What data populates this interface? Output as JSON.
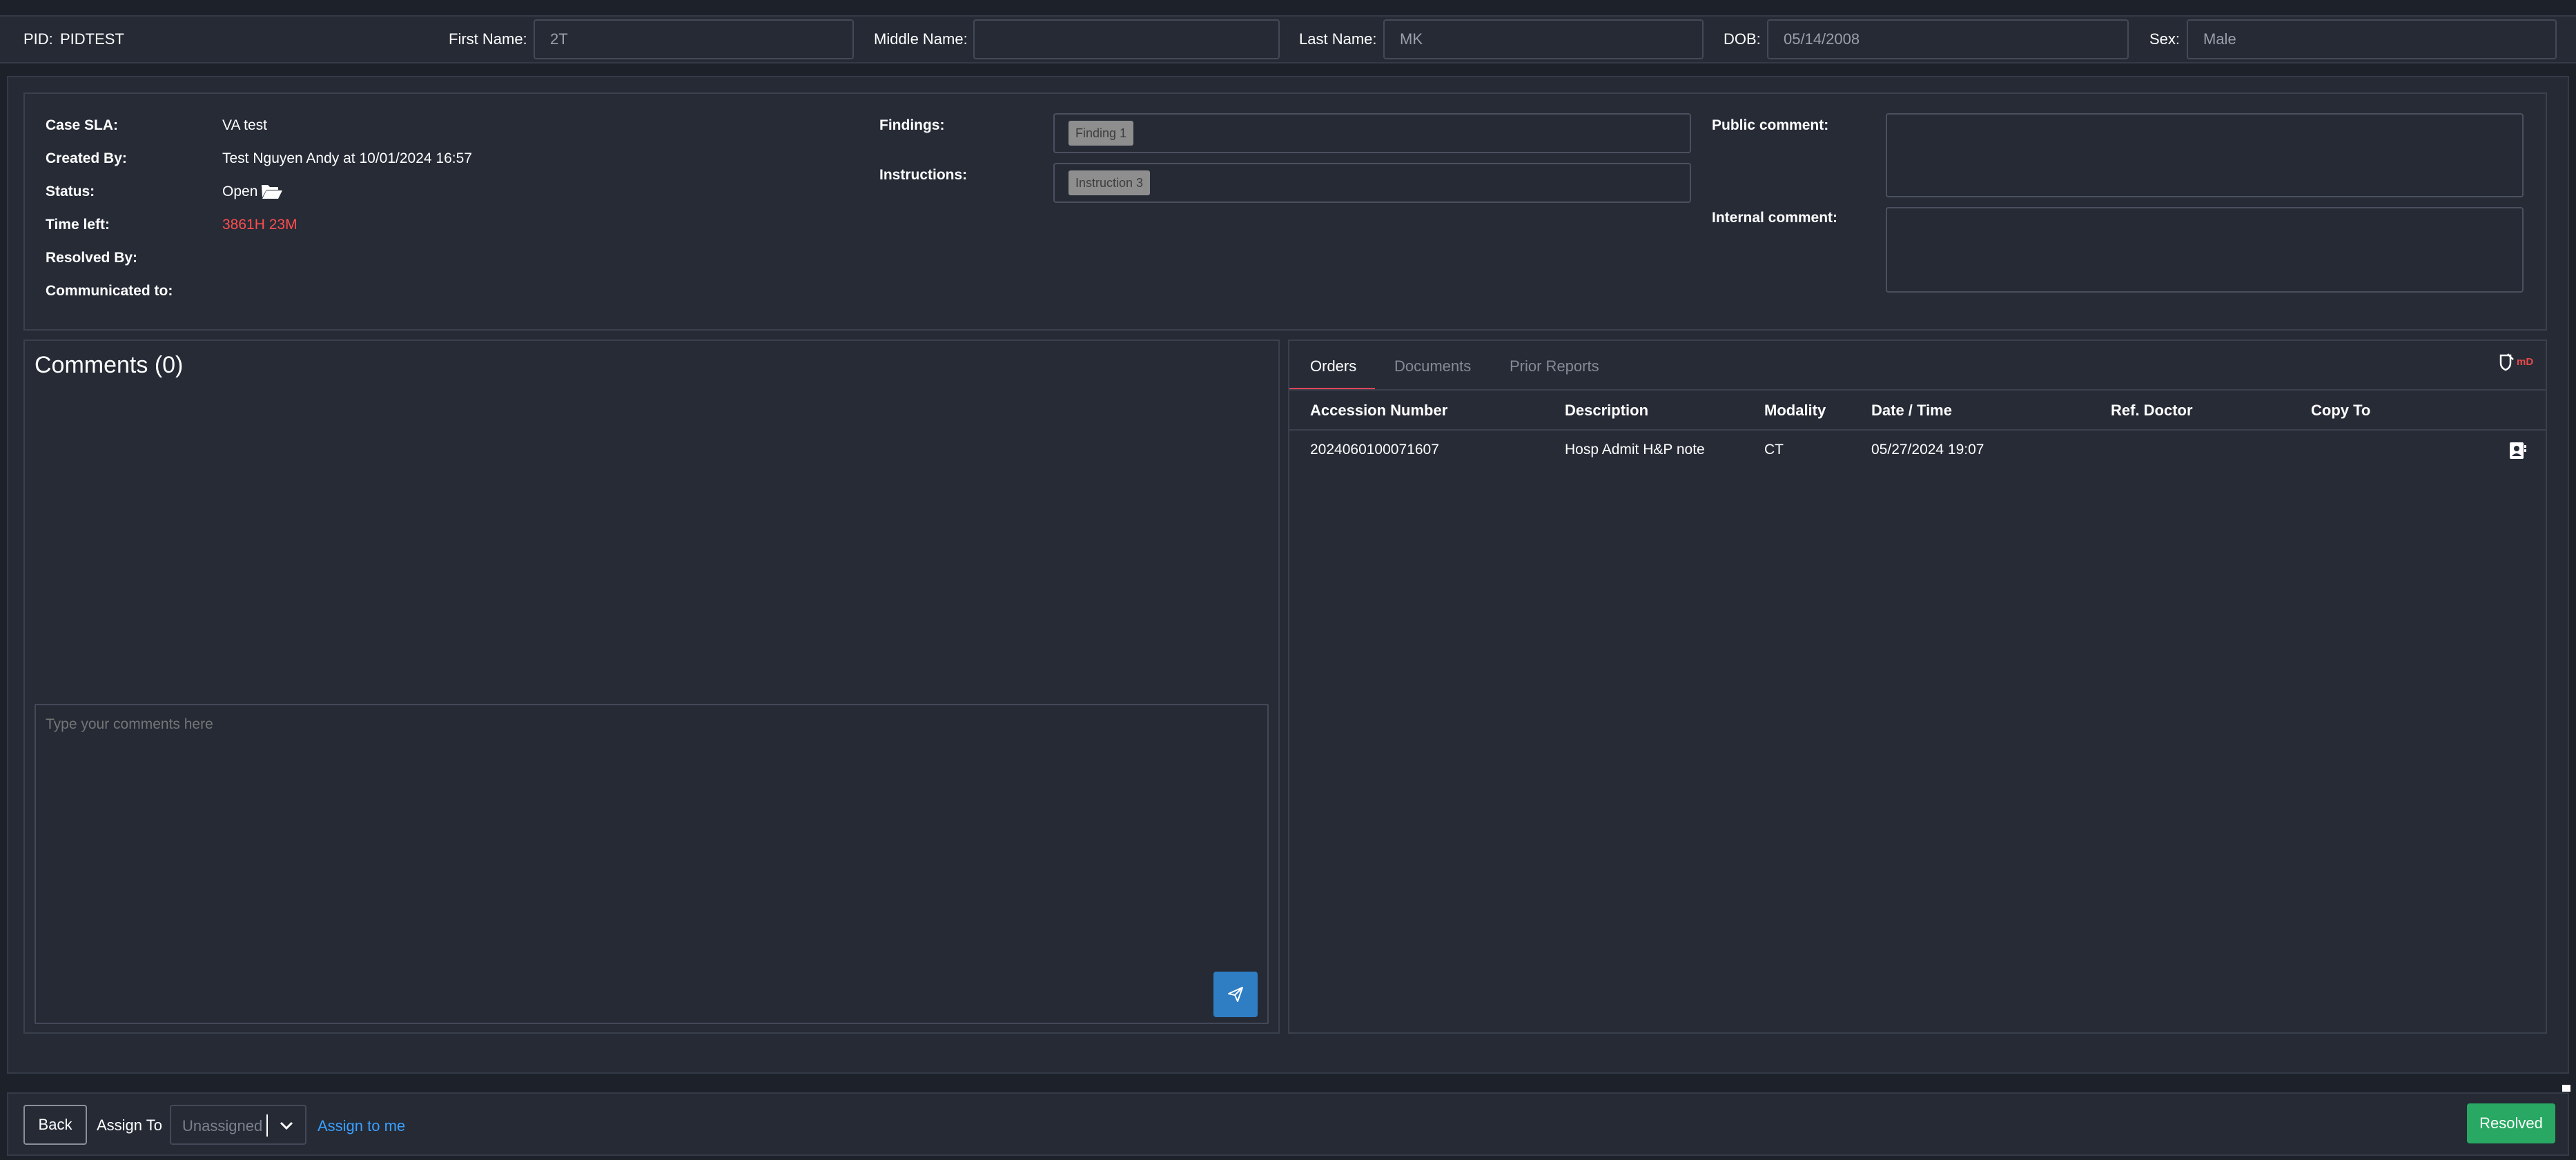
{
  "patient": {
    "pid_label": "PID:",
    "pid_value": "PIDTEST",
    "first_name_label": "First Name:",
    "first_name_value": "2T",
    "middle_name_label": "Middle Name:",
    "middle_name_value": "",
    "last_name_label": "Last Name:",
    "last_name_value": "MK",
    "dob_label": "DOB:",
    "dob_value": "05/14/2008",
    "sex_label": "Sex:",
    "sex_value": "Male"
  },
  "case": {
    "sla_label": "Case SLA:",
    "sla_value": "VA test",
    "created_by_label": "Created By:",
    "created_by_value": "Test Nguyen Andy at 10/01/2024 16:57",
    "status_label": "Status:",
    "status_value": "Open",
    "status_icon": "folder-open-icon",
    "time_left_label": "Time left:",
    "time_left_value": "3861H 23M",
    "time_left_color": "#ff4d4f",
    "resolved_by_label": "Resolved By:",
    "resolved_by_value": "",
    "communicated_label": "Communicated to:",
    "communicated_value": ""
  },
  "findings": {
    "label": "Findings:",
    "tags": [
      "Finding 1"
    ]
  },
  "instructions": {
    "label": "Instructions:",
    "tags": [
      "Instruction 3"
    ]
  },
  "public_comment": {
    "label": "Public comment:",
    "value": ""
  },
  "internal_comment": {
    "label": "Internal comment:",
    "value": ""
  },
  "comments": {
    "title": "Comments (0)",
    "placeholder": "Type your comments here",
    "send_icon": "paper-plane-icon"
  },
  "tabs": [
    {
      "label": "Orders",
      "active": true
    },
    {
      "label": "Documents",
      "active": false
    },
    {
      "label": "Prior Reports",
      "active": false
    }
  ],
  "brand": {
    "text": "mD",
    "color": "#e84a4a"
  },
  "orders": {
    "columns": [
      "Accession Number",
      "Description",
      "Modality",
      "Date / Time",
      "Ref. Doctor",
      "Copy To"
    ],
    "rows": [
      {
        "accession": "2024060100071607",
        "description": "Hosp Admit H&P note",
        "modality": "CT",
        "datetime": "05/27/2024 19:07",
        "ref_doctor": "",
        "copy_to": "",
        "action_icon": "contact-card-icon"
      }
    ]
  },
  "footer": {
    "back_label": "Back",
    "assign_to_label": "Assign To",
    "assign_placeholder": "Unassigned",
    "assign_to_me_label": "Assign to me",
    "resolved_label": "Resolved"
  },
  "colors": {
    "accent_blue": "#2f7ec4",
    "link_blue": "#3aa0ff",
    "success_green": "#28a862",
    "tab_active_underline": "#e0465a"
  }
}
